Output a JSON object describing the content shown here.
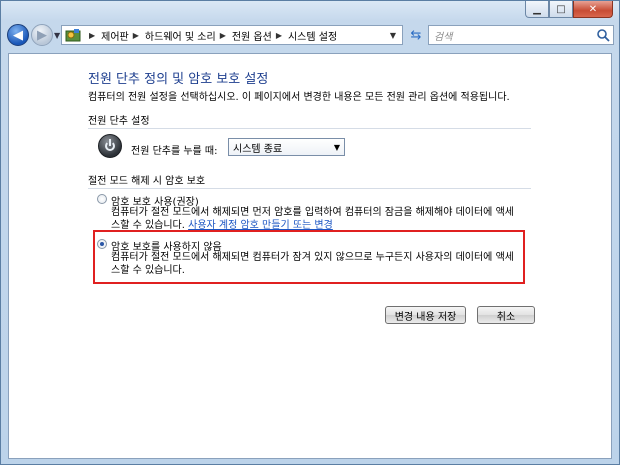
{
  "window": {
    "min_icon": "minimize-icon",
    "max_icon": "maximize-icon",
    "close_icon": "close-icon"
  },
  "breadcrumb": {
    "items": [
      "제어판",
      "하드웨어 및 소리",
      "전원 옵션",
      "시스템 설정"
    ]
  },
  "search": {
    "placeholder": "검색"
  },
  "page": {
    "title": "전원 단추 정의 및 암호 보호 설정",
    "description": "컴퓨터의 전원 설정을 선택하십시오. 이 페이지에서 변경한 내용은 모든 전원 관리 옵션에 적용됩니다."
  },
  "power_button": {
    "section_title": "전원 단추 설정",
    "label": "전원 단추를 누를 때:",
    "selected": "시스템 종료"
  },
  "wake_password": {
    "section_title": "절전 모드 해제 시 암호 보호",
    "option_require": {
      "label": "암호 보호 사용(권장)",
      "desc_line1": "컴퓨터가 절전 모드에서 해제되면 먼저 암호를 입력하여 컴퓨터의 잠금을 해제해야 데이터에 액세",
      "desc_line2": "스할 수 있습니다.",
      "link": "사용자 계정 암호 만들기 또는 변경"
    },
    "option_none": {
      "label": "암호 보호를 사용하지 않음",
      "desc_line1": "컴퓨터가 절전 모드에서 해제되면 컴퓨터가 잠겨 있지 않으므로 누구든지 사용자의 데이터에 액세",
      "desc_line2": "스할 수 있습니다.",
      "selected": true
    }
  },
  "actions": {
    "save": "변경 내용 저장",
    "cancel": "취소"
  },
  "colors": {
    "title": "#1e3f8f",
    "link": "#1b55c3",
    "highlight": "#e02020"
  }
}
